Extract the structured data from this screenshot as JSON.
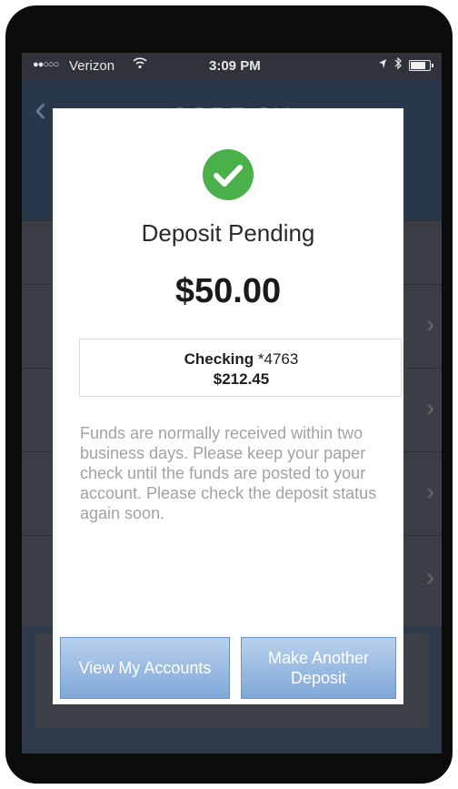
{
  "status_bar": {
    "signal": "●●○○○",
    "carrier": "Verizon",
    "time": "3:09 PM"
  },
  "app": {
    "nav_title": "CORE CU"
  },
  "modal": {
    "title": "Deposit Pending",
    "amount": "$50.00",
    "account_name": "Checking",
    "account_number": "*4763",
    "account_balance": "$212.45",
    "message": "Funds are normally received within two business days. Please keep your paper check until the funds are posted to your account. Please check the deposit status again soon.",
    "buttons": {
      "view_accounts": "View My Accounts",
      "make_another_deposit": "Make Another Deposit"
    }
  },
  "colors": {
    "success": "#4ab04a",
    "button": "#7ea7d8",
    "nav": "#283749"
  }
}
